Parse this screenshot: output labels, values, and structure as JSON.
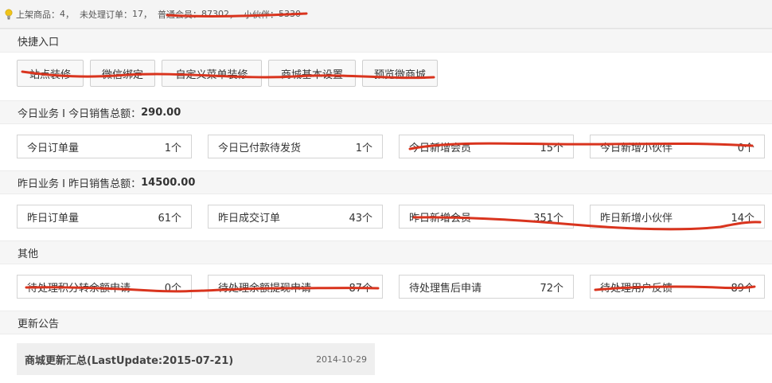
{
  "topbar": {
    "products_label": "上架商品：",
    "products_count": "4",
    "orders_label": "，  未处理订单：",
    "orders_count": "17",
    "members_label": "，  普通会员：",
    "members_count": "87302",
    "partners_label": "，  小伙伴：",
    "partners_count": "5330"
  },
  "quick_entry": {
    "header": "快捷入口",
    "buttons": [
      "站点装修",
      "微信绑定",
      "自定义菜单装修",
      "商城基本设置",
      "预览微商城"
    ]
  },
  "today": {
    "header_prefix": "今日业务 I 今日销售总额：",
    "amount": "290.00",
    "stats": [
      {
        "label": "今日订单量",
        "value": "1个"
      },
      {
        "label": "今日已付款待发货",
        "value": "1个"
      },
      {
        "label": "今日新增会员",
        "value": "15个"
      },
      {
        "label": "今日新增小伙伴",
        "value": "0个"
      }
    ]
  },
  "yesterday": {
    "header_prefix": "昨日业务 I 昨日销售总额：",
    "amount": "14500.00",
    "stats": [
      {
        "label": "昨日订单量",
        "value": "61个"
      },
      {
        "label": "昨日成交订单",
        "value": "43个"
      },
      {
        "label": "昨日新增会员",
        "value": "351个"
      },
      {
        "label": "昨日新增小伙伴",
        "value": "14个"
      }
    ]
  },
  "other": {
    "header": "其他",
    "stats": [
      {
        "label": "待处理积分转余额申请",
        "value": "0个"
      },
      {
        "label": "待处理余额提现申请",
        "value": "87个"
      },
      {
        "label": "待处理售后申请",
        "value": "72个"
      },
      {
        "label": "待处理用户反馈",
        "value": "89个"
      }
    ]
  },
  "announcements": {
    "header": "更新公告",
    "items": [
      {
        "title": "商城更新汇总(LastUpdate:2015-07-21)",
        "date": "2014-10-29"
      }
    ]
  },
  "colors": {
    "scribble": "#d9341e",
    "bulb": "#f0c419"
  }
}
